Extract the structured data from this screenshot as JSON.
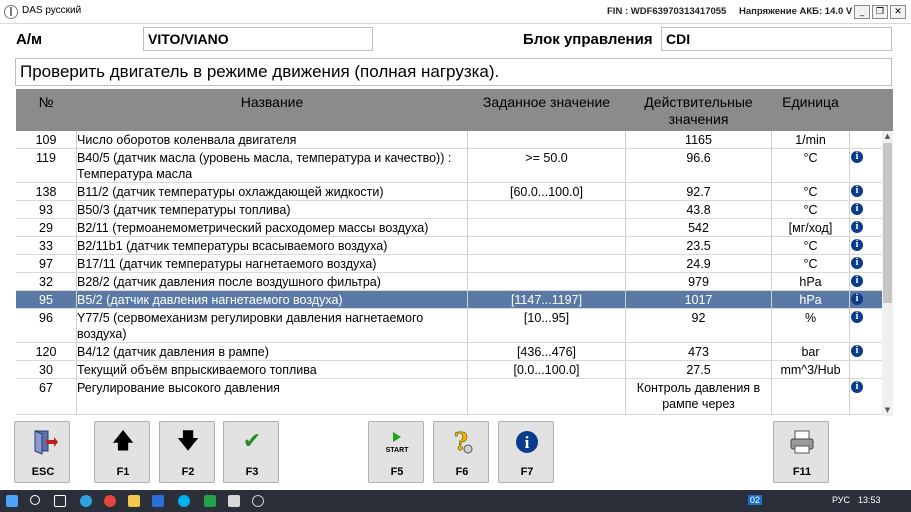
{
  "window": {
    "title": "DAS русский",
    "fin": "FIN : WDF63970313417055",
    "battery": "Напряжение АКБ: 14.0 V",
    "minimize": "_",
    "restore": "❐",
    "close": "✕"
  },
  "header": {
    "vehicle_label": "А/м",
    "vehicle_value": "VITO/VIANO",
    "unit_label": "Блок управления",
    "unit_value": "CDI",
    "instruction": "Проверить двигатель в режиме движения (полная нагрузка)."
  },
  "table": {
    "columns": {
      "num": "№",
      "name": "Название",
      "spec": "Заданное значение",
      "actual": "Действительные значения",
      "unit": "Единица"
    },
    "rows": [
      {
        "num": "109",
        "name": "Число оборотов коленвала двигателя",
        "spec": "",
        "actual": "1165",
        "unit": "1/min",
        "info": false
      },
      {
        "num": "119",
        "name": "B40/5 (датчик масла (уровень масла, температура и качество)) : Температура масла",
        "spec": ">= 50.0",
        "actual": "96.6",
        "unit": "°C",
        "info": true
      },
      {
        "num": "138",
        "name": "B11/2 (датчик температуры охлаждающей жидкости)",
        "spec": "[60.0...100.0]",
        "actual": "92.7",
        "unit": "°C",
        "info": true
      },
      {
        "num": "93",
        "name": "B50/3 (датчик температуры топлива)",
        "spec": "",
        "actual": "43.8",
        "unit": "°C",
        "info": true
      },
      {
        "num": "29",
        "name": "B2/11 (термоанемометрический расходомер массы воздуха)",
        "spec": "",
        "actual": "542",
        "unit": "[мг/ход]",
        "info": true
      },
      {
        "num": "33",
        "name": "B2/11b1 (датчик температуры всасываемого воздуха)",
        "spec": "",
        "actual": "23.5",
        "unit": "°C",
        "info": true
      },
      {
        "num": "97",
        "name": "B17/11 (датчик температуры нагнетаемого воздуха)",
        "spec": "",
        "actual": "24.9",
        "unit": "°C",
        "info": true
      },
      {
        "num": "32",
        "name": "B28/2 (датчик давления после воздушного фильтра)",
        "spec": "",
        "actual": "979",
        "unit": "hPa",
        "info": true
      },
      {
        "num": "95",
        "name": "B5/2 (датчик давления нагнетаемого воздуха)",
        "spec": "[1147...1197]",
        "actual": "1017",
        "unit": "hPa",
        "info": true,
        "selected": true
      },
      {
        "num": "96",
        "name": "Y77/5 (сервомеханизм регулировки давления нагнетаемого воздуха)",
        "spec": "[10...95]",
        "actual": "92",
        "unit": "%",
        "info": true
      },
      {
        "num": "120",
        "name": "B4/12 (датчик давления в рампе)",
        "spec": "[436...476]",
        "actual": "473",
        "unit": "bar",
        "info": true
      },
      {
        "num": "30",
        "name": "Текущий объём впрыскиваемого топлива",
        "spec": "[0.0...100.0]",
        "actual": "27.5",
        "unit": "mm^3/Hub",
        "info": false
      },
      {
        "num": "67",
        "name": "Регулирование высокого давления",
        "spec": "",
        "actual": "Контроль давления в рампе через",
        "unit": "",
        "info": true
      }
    ]
  },
  "toolbar": {
    "esc": "ESC",
    "f1": "F1",
    "f2": "F2",
    "f3": "F3",
    "f5": "F5",
    "f5_start": "START",
    "f6": "F6",
    "f7": "F7",
    "f11": "F11"
  },
  "taskbar": {
    "lang": "РУС",
    "time": "13:53",
    "badge": "02"
  },
  "colors": {
    "header_bg": "#8b8b8b",
    "selected_row": "#5a7aa5",
    "info_icon": "#0b3b8c",
    "button_bg": "#e2e2e2"
  }
}
